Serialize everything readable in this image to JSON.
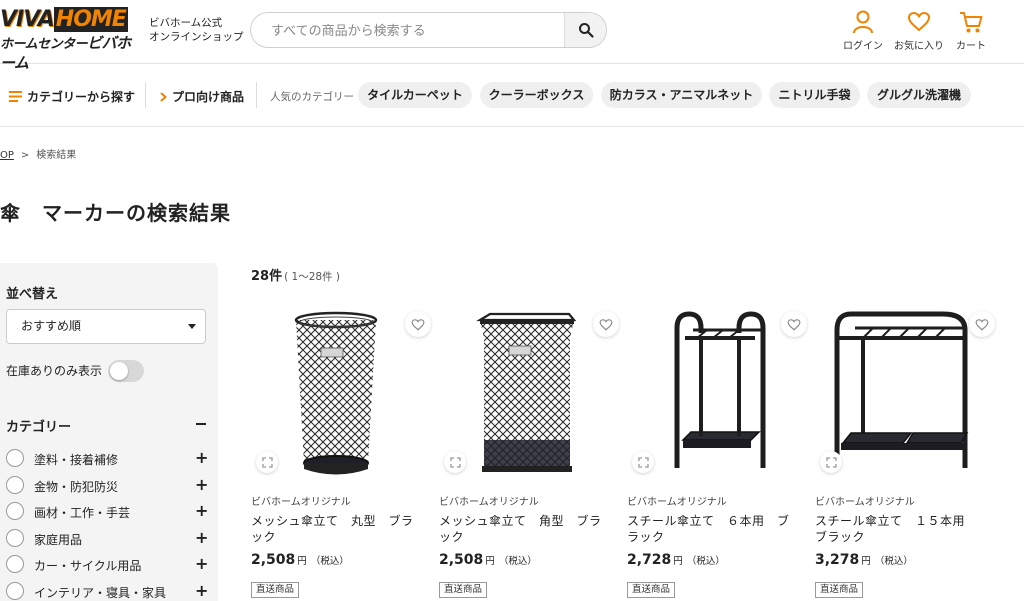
{
  "header": {
    "logo_top_a": "VIVA",
    "logo_top_b": "HOME",
    "logo_bottom_a": "ホームセンター",
    "logo_bottom_b": "ビバホーム",
    "tagline_line1": "ビバホーム公式",
    "tagline_line2": "オンラインショップ",
    "search_placeholder": "すべての商品から検索する",
    "icons": [
      {
        "icon": "person-icon",
        "label": "ログイン"
      },
      {
        "icon": "heart-icon",
        "label": "お気に入り"
      },
      {
        "icon": "cart-icon",
        "label": "カート"
      }
    ],
    "accent_color": "#f08300"
  },
  "nav": {
    "category_label": "カテゴリーから探す",
    "pro_label": "プロ向け商品",
    "popular_label": "人気のカテゴリー",
    "chips": [
      "タイルカーペット",
      "クーラーボックス",
      "防カラス・アニマルネット",
      "ニトリル手袋",
      "グルグル洗濯機"
    ]
  },
  "breadcrumb": {
    "top": "OP",
    "sep": ">",
    "current": "検索結果"
  },
  "page_title": "傘　マーカーの検索結果",
  "sidebar": {
    "sort_heading": "並べ替え",
    "sort_value": "おすすめ順",
    "stock_only_label": "在庫ありのみ表示",
    "stock_only_on": false,
    "category_heading": "カテゴリー",
    "categories": [
      "塗料・接着補修",
      "金物・防犯防災",
      "画材・工作・手芸",
      "家庭用品",
      "カー・サイクル用品",
      "インテリア・寝具・家具"
    ]
  },
  "results": {
    "count": "28件",
    "range": "( 1〜28件 )",
    "products": [
      {
        "brand": "ビバホームオリジナル",
        "name": "メッシュ傘立て　丸型　ブラック",
        "price": "2,508",
        "yen": "円",
        "tax": "（税込）",
        "badge": "直送商品",
        "image": "round-mesh-umbrella-stand"
      },
      {
        "brand": "ビバホームオリジナル",
        "name": "メッシュ傘立て　角型　ブラック",
        "price": "2,508",
        "yen": "円",
        "tax": "（税込）",
        "badge": "直送商品",
        "image": "square-mesh-umbrella-stand"
      },
      {
        "brand": "ビバホームオリジナル",
        "name": "スチール傘立て　６本用　ブラック",
        "price": "2,728",
        "yen": "円",
        "tax": "（税込）",
        "badge": "直送商品",
        "image": "steel-umbrella-stand-6"
      },
      {
        "brand": "ビバホームオリジナル",
        "name": "スチール傘立て　１５本用　ブラック",
        "price": "3,278",
        "yen": "円",
        "tax": "（税込）",
        "badge": "直送商品",
        "image": "steel-umbrella-stand-15"
      }
    ]
  }
}
